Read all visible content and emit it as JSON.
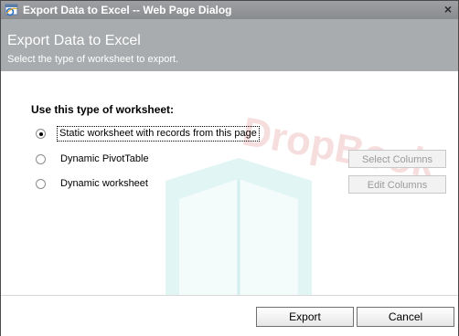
{
  "window": {
    "title": "Export Data to Excel -- Web Page Dialog",
    "close_glyph": "×",
    "icon": "ie-icon"
  },
  "header": {
    "title": "Export Data to Excel",
    "subtitle": "Select the type of worksheet to export."
  },
  "options": {
    "section_label": "Use this type of worksheet:",
    "items": [
      {
        "label": "Static worksheet with records from this page",
        "selected": true
      },
      {
        "label": "Dynamic PivotTable",
        "selected": false
      },
      {
        "label": "Dynamic worksheet",
        "selected": false
      }
    ]
  },
  "side_buttons": {
    "select_columns": "Select Columns",
    "edit_columns": "Edit Columns"
  },
  "footer": {
    "export_label": "Export",
    "cancel_label": "Cancel"
  },
  "watermark": "DropBook",
  "colors": {
    "titlebar": "#9ea0a3",
    "header": "#a9acae",
    "watermark_red": "#f6dede",
    "watermark_teal": "#e2f5f5"
  }
}
